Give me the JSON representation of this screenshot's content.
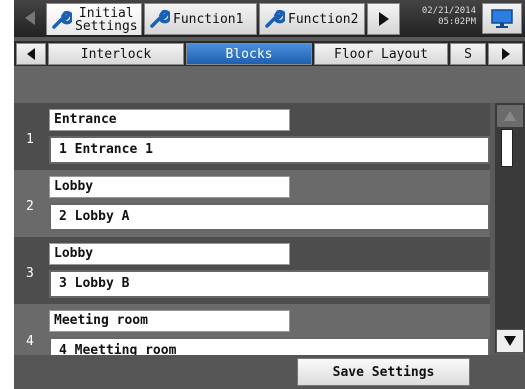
{
  "top_tabs": [
    {
      "label_line1": "Initial",
      "label_line2": "Settings"
    },
    {
      "label": "Function1"
    },
    {
      "label": "Function2"
    }
  ],
  "datetime": {
    "date": "02/21/2014",
    "time": "05:02PM"
  },
  "sub_tabs": [
    {
      "label": "Interlock"
    },
    {
      "label": "Blocks"
    },
    {
      "label": "Floor Layout"
    },
    {
      "label": "S"
    }
  ],
  "rows": [
    {
      "number": "1",
      "group": "Entrance",
      "block": "1 Entrance 1"
    },
    {
      "number": "2",
      "group": "Lobby",
      "block": "2 Lobby A"
    },
    {
      "number": "3",
      "group": "Lobby",
      "block": "3 Lobby B"
    },
    {
      "number": "4",
      "group": "Meeting room",
      "block": "4 Meetting room"
    }
  ],
  "footer": {
    "save_label": "Save Settings"
  },
  "icons": {
    "left_arrow": "left-arrow-icon",
    "right_arrow": "right-arrow-icon",
    "wrench": "wrench-icon",
    "monitor": "monitor-icon"
  },
  "colors": {
    "active_subtab": "#1d5fb0",
    "background": "#5a5a5a"
  }
}
